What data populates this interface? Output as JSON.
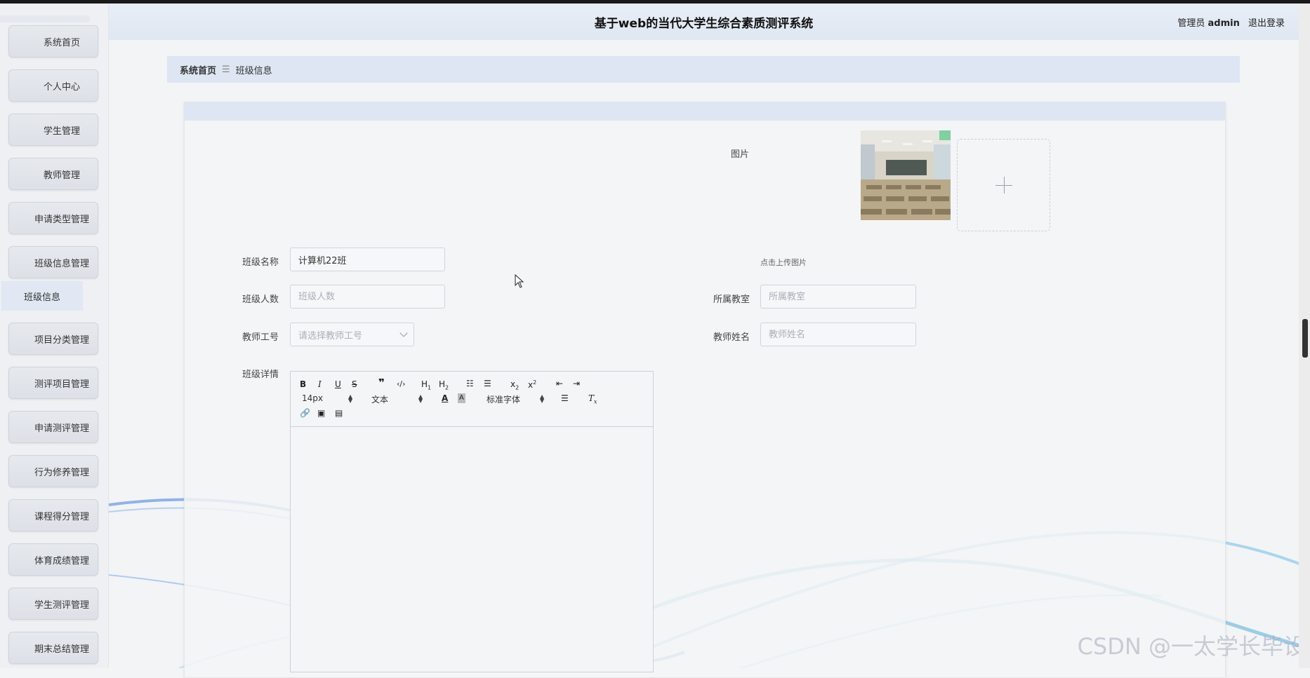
{
  "header": {
    "title": "基于web的当代大学生综合素质测评系统",
    "role": "管理员",
    "username": "admin",
    "logout": "退出登录"
  },
  "sidebar": {
    "items": [
      {
        "label": "系统首页"
      },
      {
        "label": "个人中心"
      },
      {
        "label": "学生管理"
      },
      {
        "label": "教师管理"
      },
      {
        "label": "申请类型管理"
      },
      {
        "label": "班级信息管理"
      },
      {
        "label": "项目分类管理"
      },
      {
        "label": "测评项目管理"
      },
      {
        "label": "申请测评管理"
      },
      {
        "label": "行为修养管理"
      },
      {
        "label": "课程得分管理"
      },
      {
        "label": "体育成绩管理"
      },
      {
        "label": "学生测评管理"
      },
      {
        "label": "期末总结管理"
      }
    ],
    "sub_item": "班级信息"
  },
  "breadcrumb": {
    "home": "系统首页",
    "current": "班级信息"
  },
  "form": {
    "image_label": "图片",
    "upload_tip": "点击上传图片",
    "class_name_label": "班级名称",
    "class_name_value": "计算机22班",
    "class_size_label": "班级人数",
    "class_size_placeholder": "班级人数",
    "classroom_label": "所属教室",
    "classroom_placeholder": "所属教室",
    "teacher_id_label": "教师工号",
    "teacher_id_placeholder": "请选择教师工号",
    "teacher_name_label": "教师姓名",
    "teacher_name_placeholder": "教师姓名",
    "details_label": "班级详情"
  },
  "editor": {
    "font_size": "14px",
    "text_style": "文本",
    "font_family": "标准字体"
  },
  "watermark": "CSDN @一太学长毕设",
  "colors": {
    "accent": "#dde6f2",
    "sidebar_button": "#e1e5eb"
  }
}
